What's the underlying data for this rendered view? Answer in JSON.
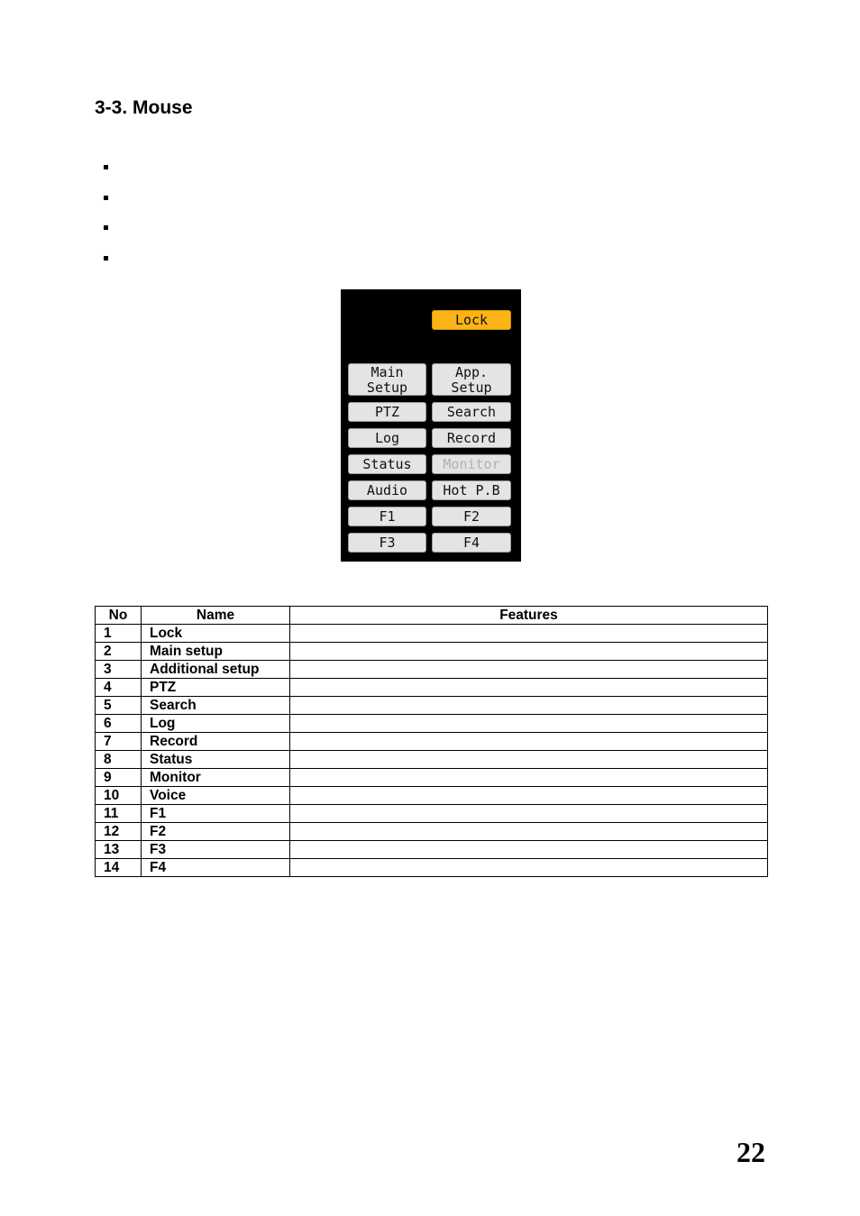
{
  "heading": "3-3. Mouse",
  "bullets": [
    "",
    "",
    "",
    ""
  ],
  "menu": {
    "lock": "Lock",
    "buttons": [
      {
        "label_line1": "Main",
        "label_line2": "Setup"
      },
      {
        "label_line1": "App.",
        "label_line2": "Setup"
      },
      {
        "label": "PTZ"
      },
      {
        "label": "Search"
      },
      {
        "label": "Log"
      },
      {
        "label": "Record"
      },
      {
        "label": "Status"
      },
      {
        "label": "Monitor",
        "disabled": true
      },
      {
        "label": "Audio"
      },
      {
        "label": "Hot P.B"
      },
      {
        "label": "F1"
      },
      {
        "label": "F2"
      },
      {
        "label": "F3"
      },
      {
        "label": "F4"
      }
    ],
    "colors": {
      "lock": "#fbb316",
      "button": "#e4e4e4",
      "background": "#000000",
      "disabled_text": "#b0b0b0"
    }
  },
  "table": {
    "headers": [
      "No",
      "Name",
      "Features"
    ],
    "rows": [
      {
        "no": "1",
        "name": "Lock",
        "features": ""
      },
      {
        "no": "2",
        "name": "Main setup",
        "features": ""
      },
      {
        "no": "3",
        "name": "Additional setup",
        "features": ""
      },
      {
        "no": "4",
        "name": "PTZ",
        "features": ""
      },
      {
        "no": "5",
        "name": "Search",
        "features": ""
      },
      {
        "no": "6",
        "name": "Log",
        "features": ""
      },
      {
        "no": "7",
        "name": "Record",
        "features": ""
      },
      {
        "no": "8",
        "name": "Status",
        "features": ""
      },
      {
        "no": "9",
        "name": "Monitor",
        "features": ""
      },
      {
        "no": "10",
        "name": "Voice",
        "features": ""
      },
      {
        "no": "11",
        "name": "F1",
        "features": ""
      },
      {
        "no": "12",
        "name": "F2",
        "features": ""
      },
      {
        "no": "13",
        "name": "F3",
        "features": ""
      },
      {
        "no": "14",
        "name": "F4",
        "features": ""
      }
    ]
  },
  "page_number": "22"
}
